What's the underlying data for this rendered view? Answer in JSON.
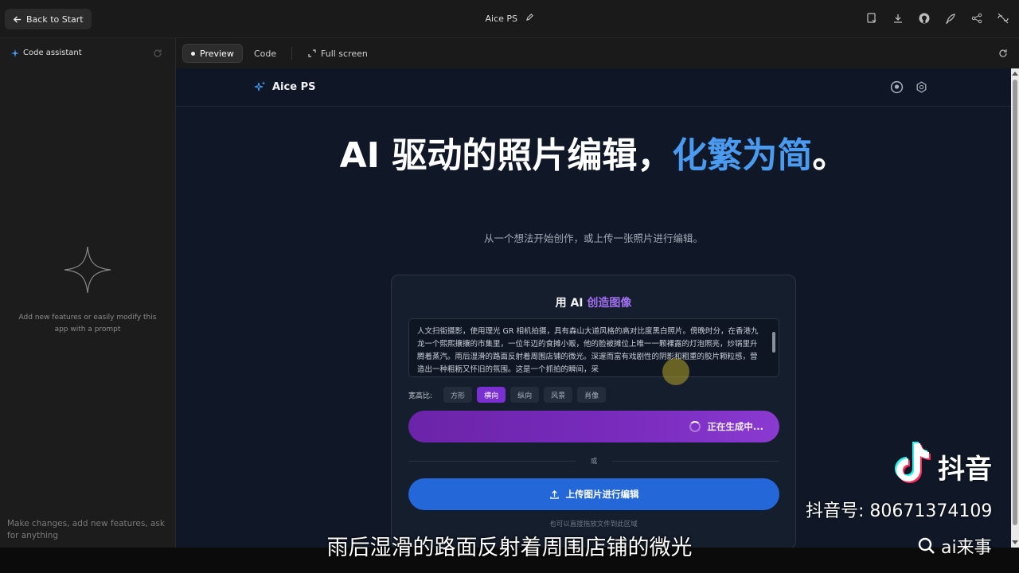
{
  "topbar": {
    "back_label": "Back to Start",
    "app_title": "Aice PS"
  },
  "sidebar": {
    "title": "Code assistant",
    "hint": "Add new features or easily modify this app with a prompt",
    "input_placeholder": "Make changes, add new features, ask for anything"
  },
  "tabs": {
    "preview": "Preview",
    "code": "Code",
    "fullscreen": "Full screen"
  },
  "app": {
    "brand": "Aice PS",
    "hero_main": "AI 驱动的照片编辑，",
    "hero_accent": "化繁为简",
    "hero_end": "。",
    "subheading": "从一个想法开始创作，或上传一张照片进行编辑。",
    "card_title_prefix": "用 AI ",
    "card_title_accent": "创造图像",
    "prompt_text": "人文扫街摄影，使用理光 GR 相机拍摄，具有森山大道风格的高对比度黑白照片。傍晚时分，在香港九龙一个熙熙攘攘的市集里，一位年迈的食摊小贩，他的脸被摊位上唯一一颗裸露的灯泡照亮，炒锅里升腾着蒸汽。雨后湿滑的路面反射着周围店铺的微光。深邃而富有戏剧性的阴影和粗重的胶片颗粒感，营造出一种粗粝又怀旧的氛围。这是一个抓拍的瞬间，采",
    "ratio_label": "宽高比:",
    "ratios": [
      "方形",
      "横向",
      "纵向",
      "风景",
      "肖像"
    ],
    "generate_label": "正在生成中...",
    "or_label": "或",
    "upload_label": "上传图片进行编辑",
    "drop_hint": "也可以直接拖放文件到此区域"
  },
  "overlay": {
    "subtitle": "雨后湿滑的路面反射着周围店铺的微光",
    "platform": "抖音",
    "account_id": "抖音号: 80671374109",
    "search_name": "ai来事"
  },
  "colors": {
    "accent_blue": "#4a9bf0",
    "accent_purple": "#a070f0",
    "generate_button": "#7a2cbe",
    "upload_button": "#2367d9",
    "selected_chip": "#7a2fd0"
  }
}
